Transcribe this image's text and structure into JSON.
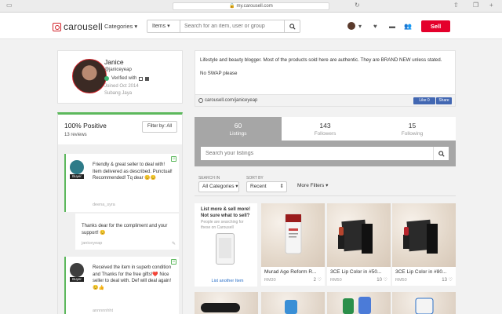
{
  "browser": {
    "url": "my.carousell.com"
  },
  "header": {
    "logo_text": "carousell",
    "categories_label": "Categories",
    "search_scope": "Items",
    "search_placeholder": "Search for an item, user or group",
    "sell_label": "Sell"
  },
  "profile": {
    "name": "Janice",
    "handle": "@janiceyeap",
    "verified_text": "Verified with",
    "joined": "Joined Oct 2014",
    "location": "Subang Jaya"
  },
  "reviews": {
    "positive": "100% Positive",
    "count": "13 reviews",
    "filter_label": "Filter by: All",
    "items": [
      {
        "badge": "Buyer",
        "text": "Friendly & great seller to deal with! Item delivered as described. Punctual! Recommended! Tq dear 😊😊",
        "user": "deena_syra"
      },
      {
        "text": "Thanks dear for the compliment and your support! 😊",
        "user": "janiceyeap"
      },
      {
        "badge": "Buyer",
        "text": "Received the item in superb condition and Thanks for the free gifts!❤️ Nice seller to deal with. Def will deal again! 😊👍",
        "user": "annnnnhht"
      }
    ]
  },
  "description": {
    "line1": "Lifestyle and beauty blogger. Most of the products sold here are authentic. They are BRAND NEW unless stated.",
    "line2": "No SWAP please",
    "link": "carousell.com/janiceyeap",
    "like_label": "Like 0",
    "share_label": "Share"
  },
  "tabs": [
    {
      "num": "60",
      "label": "Listings"
    },
    {
      "num": "143",
      "label": "Followers"
    },
    {
      "num": "15",
      "label": "Following"
    }
  ],
  "listing_search_placeholder": "Search your listings",
  "filters": {
    "search_in_label": "SEARCH IN",
    "search_in_value": "All Categories",
    "sort_label": "SORT BY",
    "sort_value": "Recent",
    "more_label": "More Filters"
  },
  "promo": {
    "title": "List more & sell more! Not sure what to sell?",
    "sub": "People are searching for these on Carousell",
    "link": "List another Item"
  },
  "cards": [
    {
      "title": "Murad Age Reform R...",
      "price": "RM30",
      "likes": "2"
    },
    {
      "title": "3CE Lip Color in #50...",
      "price": "RM50",
      "likes": "10"
    },
    {
      "title": "3CE Lip Color in #80...",
      "price": "RM50",
      "likes": "13"
    }
  ]
}
